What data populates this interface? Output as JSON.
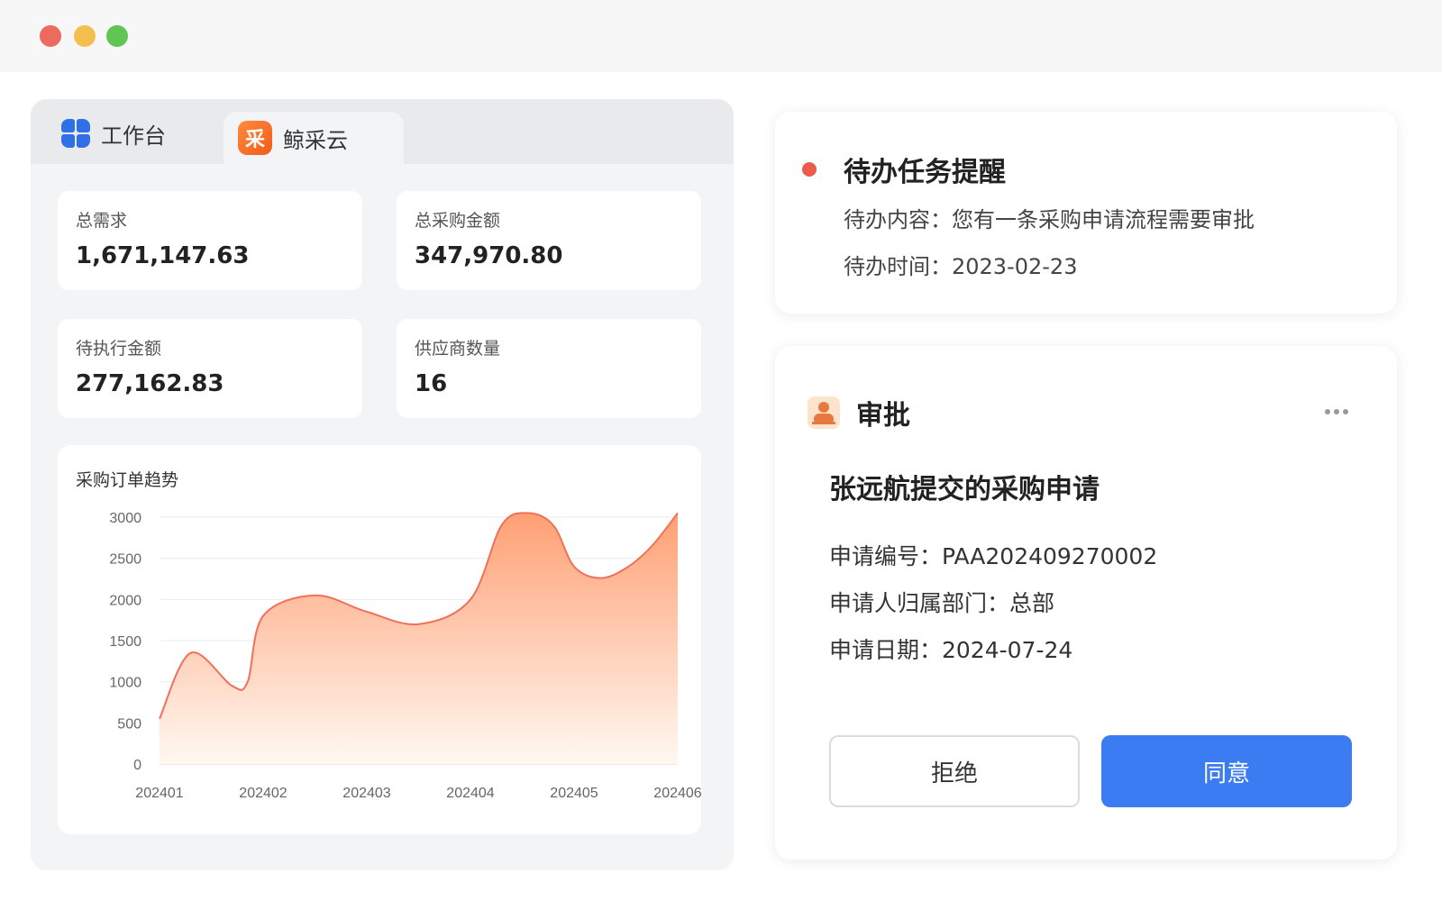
{
  "window": {
    "controls": [
      "close",
      "minimize",
      "maximize"
    ],
    "colors": {
      "close": "#ec6a5e",
      "minimize": "#f5bf4f",
      "maximize": "#61c554"
    }
  },
  "tabs": [
    {
      "label": "工作台",
      "icon": "workbench-icon"
    },
    {
      "label": "鲸采云",
      "icon": "jingcaiyun-logo-icon",
      "icon_text": "采",
      "active": true
    }
  ],
  "stats": [
    {
      "label": "总需求",
      "value": "1,671,147.63"
    },
    {
      "label": "总采购金额",
      "value": "347,970.80"
    },
    {
      "label": "待执行金额",
      "value": "277,162.83"
    },
    {
      "label": "供应商数量",
      "value": "16"
    }
  ],
  "chart_data": {
    "type": "area",
    "title": "采购订单趋势",
    "xlabel": "",
    "ylabel": "",
    "categories": [
      "202401",
      "202402",
      "202403",
      "202404",
      "202405",
      "202406"
    ],
    "x": [
      202401.0,
      202401.3,
      202401.7,
      202401.85,
      202402.0,
      202402.5,
      202403.0,
      202403.5,
      202404.0,
      202404.3,
      202404.55,
      202404.8,
      202405.0,
      202405.25,
      202405.5,
      202405.75,
      202406.0
    ],
    "values": [
      550,
      1350,
      950,
      1000,
      1800,
      2050,
      1850,
      1700,
      2000,
      2900,
      3050,
      2900,
      2400,
      2260,
      2380,
      2650,
      3050
    ],
    "ylim": [
      0,
      3000
    ],
    "yticks": [
      0,
      500,
      1000,
      1500,
      2000,
      2500,
      3000
    ],
    "grid": true,
    "line_color": "#f0705a",
    "fill_top": "#ff9a6c",
    "fill_bottom": "#fff7ef"
  },
  "todo": {
    "title": "待办任务提醒",
    "content": "待办内容：您有一条采购申请流程需要审批",
    "time": "待办时间：2023-02-23",
    "dot_color": "#ec5b4c"
  },
  "approval": {
    "title": "审批",
    "subject": "张远航提交的采购申请",
    "fields": [
      "申请编号：PAA202409270002",
      "申请人归属部门：总部",
      "申请日期：2024-07-24"
    ],
    "reject_label": "拒绝",
    "agree_label": "同意",
    "agree_color": "#3b7cf3"
  }
}
